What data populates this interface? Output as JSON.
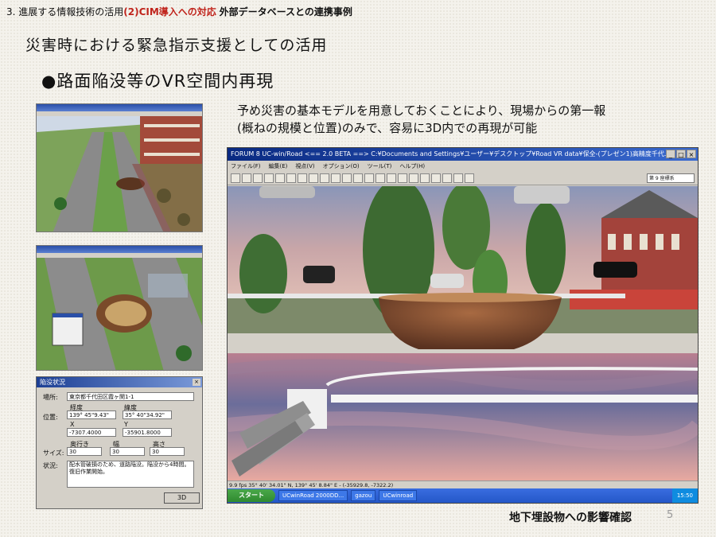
{
  "header": {
    "prefix": "3. 進展する情報技術の活用",
    "highlight": "(2)CIM導入への対応",
    "suffix": "外部データベースとの連携事例"
  },
  "title": "災害時における緊急指示支援としての活用",
  "subtitle": "●路面陥没等のVR空間内再現",
  "description": {
    "line1": "予め災害の基本モデルを用意しておくことにより、現場からの第一報",
    "line2": "(概ねの規模と位置)のみで、容易に3D内での再現が可能"
  },
  "caption": "地下埋設物への影響確認",
  "page_number": "5",
  "dialog": {
    "title": "陥没状況",
    "close": "×",
    "place_label": "場所:",
    "place_value": "東京都千代田区霞ヶ関1-1",
    "position_label": "位置:",
    "longitude_label": "経度",
    "latitude_label": "緯度",
    "longitude_value": "139° 45\"9.43\"",
    "latitude_value": "35° 40\"34.92\"",
    "x_label": "X",
    "y_label": "Y",
    "x_value": "-7307.4000",
    "y_value": "-35901.8000",
    "size_label": "サイズ:",
    "depth_label": "奥行き",
    "width_label": "幅",
    "height_label": "高さ",
    "depth_value": "30",
    "width_value": "30",
    "height_value": "30",
    "status_label": "状況:",
    "status_value": "配水管破損のため、道路陥没。陥没から4時間。復旧作業開始。",
    "button": "3D"
  },
  "window": {
    "title": "FORUM 8   UC-win/Road  <== 2.0 BETA ==>   C:¥Documents and Settings¥ユーザー¥デスクトップ¥Road VR data¥保全-(プレゼン1)高精度千代..",
    "ctrl_min": "_",
    "ctrl_max": "□",
    "ctrl_close": "×",
    "menu": [
      "ファイル(F)",
      "編集(E)",
      "視点(V)",
      "オプション(O)",
      "ツール(T)",
      "ヘルプ(H)"
    ],
    "toolbar_right": "第 9 座標系",
    "status": "9.9 fps       35° 40' 34.01\" N, 139° 45' 8.84\" E  -  (-35929.8, -7322.2)",
    "taskbar": {
      "start": "スタート",
      "tasks": [
        "UCwinRoad 2000DD...",
        "gazou",
        "UCwinroad"
      ],
      "tray": "15:50"
    }
  },
  "colors": {
    "highlight": "#c0241c",
    "titlebar": "#0a2a82",
    "taskbar": "#2457c8"
  }
}
